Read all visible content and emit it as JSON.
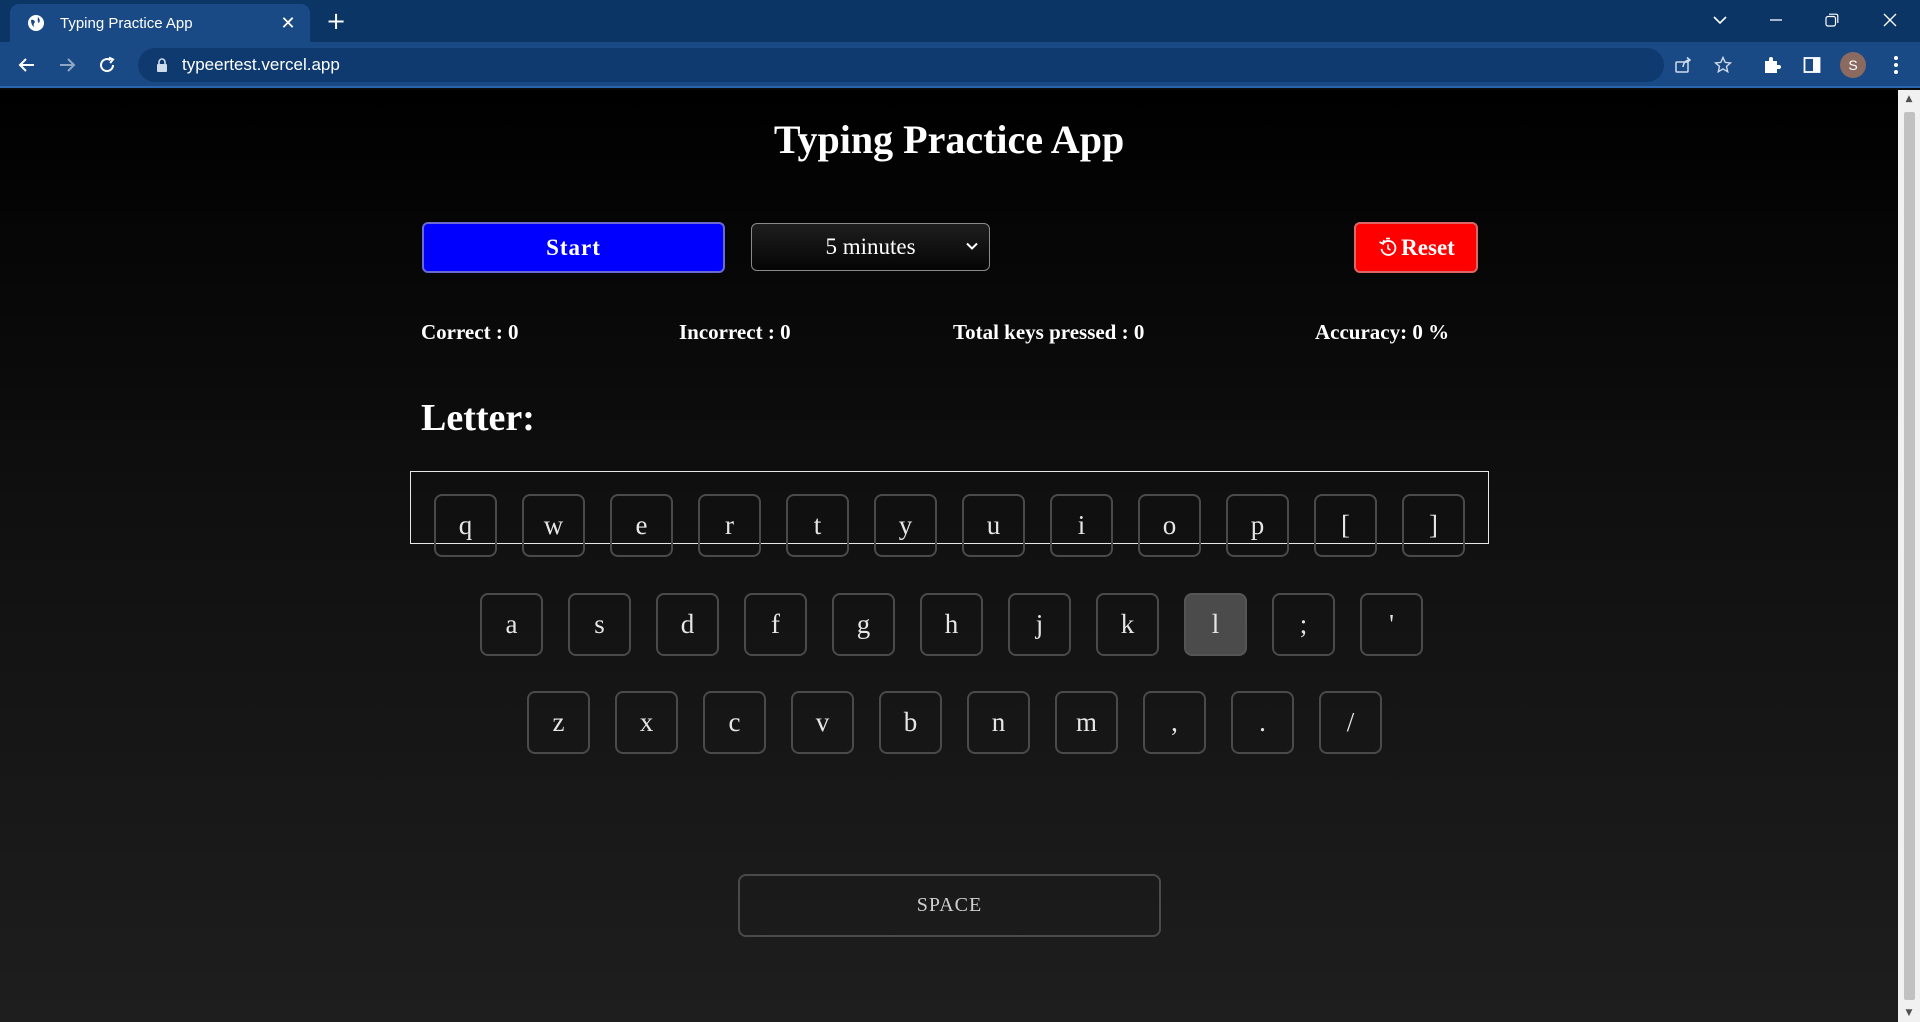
{
  "browser": {
    "tab_title": "Typing Practice App",
    "tab_close": "✕",
    "new_tab": "+",
    "url": "typeertest.vercel.app",
    "profile_initial": "S"
  },
  "app": {
    "title": "Typing Practice App",
    "start_label": "Start",
    "duration_selected": "5 minutes",
    "reset_label": "Reset",
    "stats": {
      "correct": "Correct : 0",
      "incorrect": "Incorrect : 0",
      "total": "Total keys pressed : 0",
      "accuracy": "Accuracy: 0 %"
    },
    "letter_label": "Letter:",
    "letter_value": "",
    "keyboard": {
      "row1": [
        "q",
        "w",
        "e",
        "r",
        "t",
        "y",
        "u",
        "i",
        "o",
        "p",
        "[",
        "]"
      ],
      "row2": [
        "a",
        "s",
        "d",
        "f",
        "g",
        "h",
        "j",
        "k",
        "l",
        ";",
        "'"
      ],
      "row3": [
        "z",
        "x",
        "c",
        "v",
        "b",
        "n",
        "m",
        ",",
        ".",
        "/"
      ],
      "space_label": "SPACE",
      "highlighted_key": "l"
    }
  },
  "colors": {
    "start_button": "#0000ff",
    "reset_button": "#ff0000",
    "chrome_frame": "#0b3565",
    "chrome_toolbar": "#1a4a85"
  }
}
